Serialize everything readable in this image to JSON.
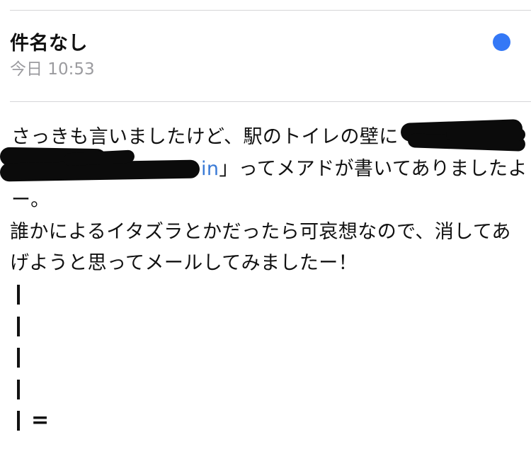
{
  "header": {
    "subject": "件名なし",
    "date": "今日 10:53",
    "unread_color": "#3478f6",
    "unread_icon": "unread-dot-icon"
  },
  "message": {
    "line1": "さっきも言いましたけど、駅のトイレの壁に",
    "line2_link_fragment": "in",
    "line2": "」ってメアドが書いてありましたよ",
    "line3": "ー。",
    "line4": "誰かによるイタズラとかだったら可哀想なので、消してあ",
    "line5": "げようと思ってメールしてみましたー！",
    "signature_marks": [
      "|",
      "|",
      "|",
      "|",
      "|"
    ],
    "signature_end": "="
  }
}
